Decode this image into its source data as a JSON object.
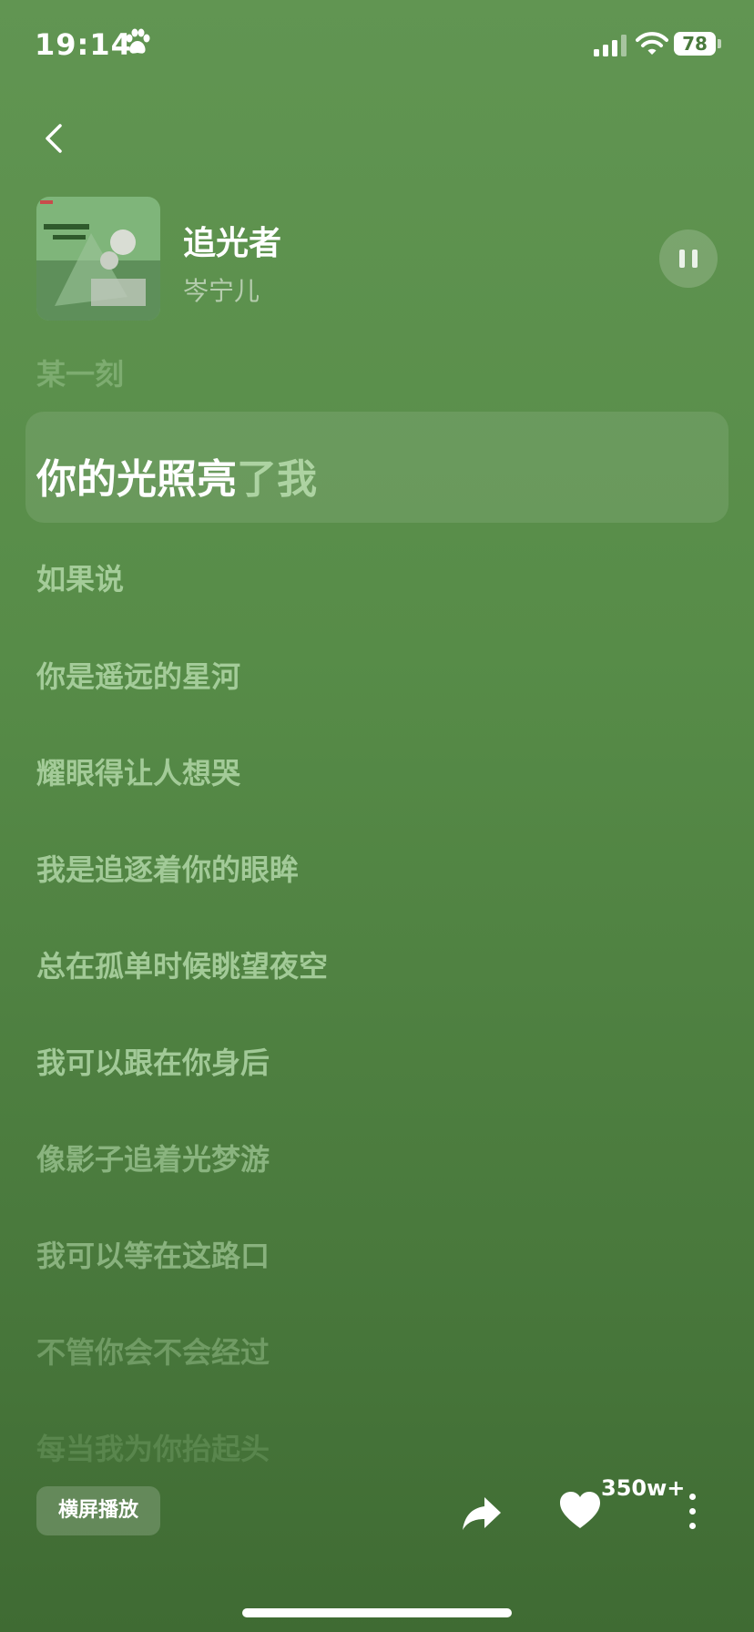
{
  "status_bar": {
    "time": "19:14",
    "battery": "78"
  },
  "song": {
    "title": "追光者",
    "artist": "岑宁儿"
  },
  "lyrics": {
    "previous": "某一刻",
    "current_sung": "你的光照亮",
    "current_unsung": "了我",
    "upcoming": [
      "如果说",
      "你是遥远的星河",
      "耀眼得让人想哭",
      "我是追逐着你的眼眸",
      "总在孤单时候眺望夜空",
      "我可以跟在你身后",
      "像影子追着光梦游",
      "我可以等在这路口",
      "不管你会不会经过",
      "每当我为你抬起头"
    ]
  },
  "controls": {
    "landscape_label": "横屏播放",
    "like_count": "350w+"
  },
  "colors": {
    "background_top": "#619552",
    "background_bottom": "#3f6b33",
    "accent": "#ffffff"
  }
}
